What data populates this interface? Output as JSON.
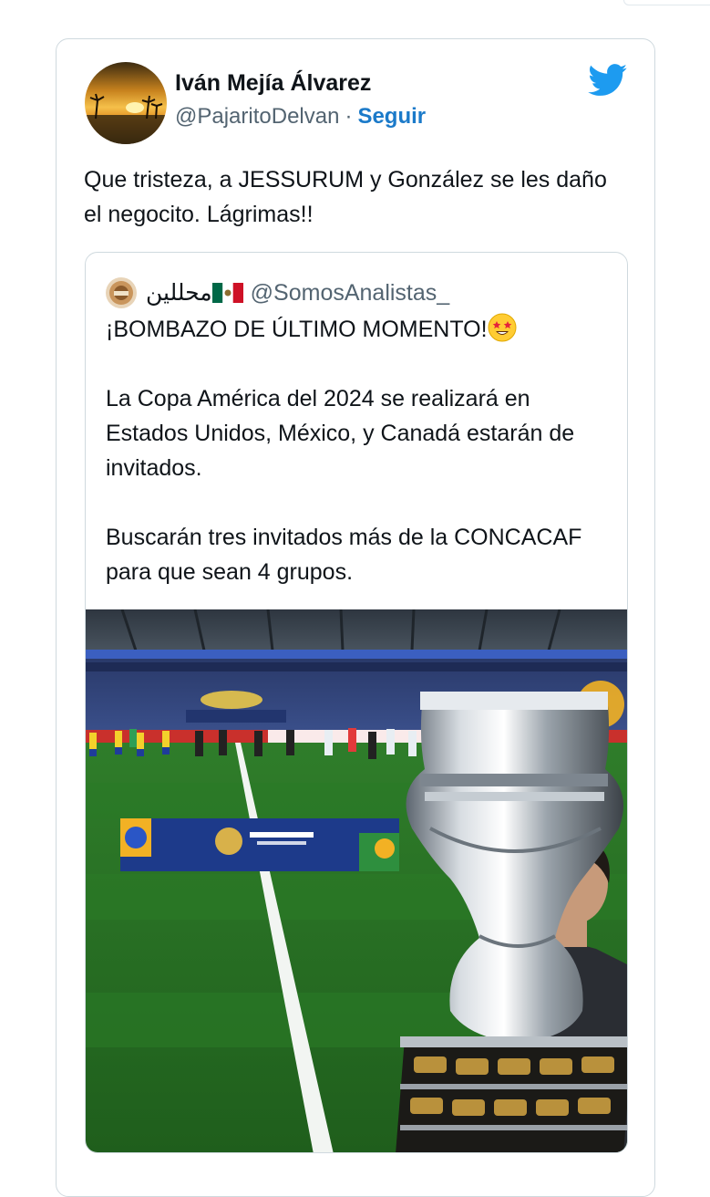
{
  "tweet": {
    "author_name": "Iván Mejía Álvarez",
    "author_handle": "@PajaritoDelvan",
    "separator": "·",
    "follow_label": "Seguir",
    "text": "Que tristeza, a JESSURUM y González se les daño el negocito. Lágrimas!!"
  },
  "quoted_tweet": {
    "display_name": "محللين",
    "handle": "@SomosAnalistas_",
    "headline": "¡BOMBAZO DE ÚLTIMO MOMENTO!",
    "paragraph_1": "La Copa América del 2024 se realizará en Estados Unidos, México, y Canadá estarán de invitados.",
    "paragraph_2": "Buscarán tres invitados más de la CONCACAF para que sean 4 grupos."
  },
  "icons": {
    "brand": "twitter-bird-icon",
    "flag": "mexico-flag-icon",
    "emoji": "star-struck-emoji-icon"
  },
  "colors": {
    "twitter_blue": "#1d9bf0",
    "follow_link": "#1b7ac9",
    "text_primary": "#0f1419",
    "text_secondary": "#536471",
    "card_border": "#cfd9de"
  }
}
